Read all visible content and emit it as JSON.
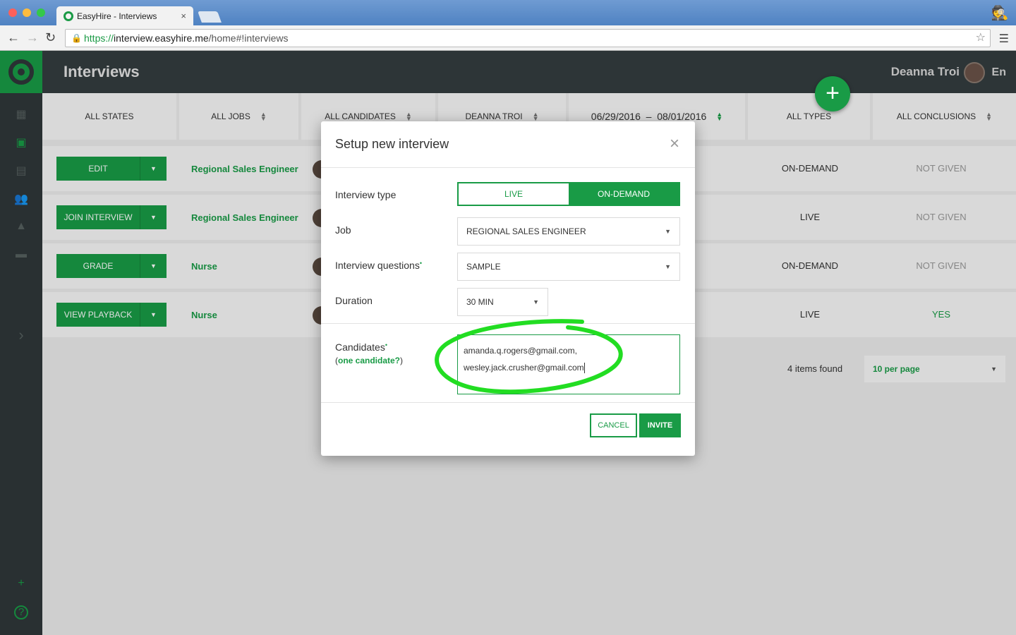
{
  "browser": {
    "tab_title": "EasyHire - Interviews",
    "tab_close": "×",
    "url_scheme": "https://",
    "url_host": "interview.easyhire.me",
    "url_path": "/home#!interviews"
  },
  "header": {
    "title": "Interviews",
    "user_name": "Deanna Troi",
    "language": "En",
    "add_button": "+"
  },
  "filters": [
    {
      "label": "ALL STATES",
      "sortable": false
    },
    {
      "label": "ALL JOBS",
      "sortable": true
    },
    {
      "label": "ALL CANDIDATES",
      "sortable": true
    },
    {
      "label": "DEANNA TROI",
      "sortable": true
    },
    {
      "label": "06/29/2016  –  08/01/2016",
      "sortable": true
    },
    {
      "label": "ALL TYPES",
      "sortable": false
    },
    {
      "label": "ALL CONCLUSIONS",
      "sortable": true
    }
  ],
  "rows": [
    {
      "action": "EDIT",
      "job": "Regional Sales Engineer",
      "type": "ON-DEMAND",
      "conclusion": "NOT GIVEN"
    },
    {
      "action": "JOIN INTERVIEW",
      "job": "Regional Sales Engineer",
      "type": "LIVE",
      "conclusion": "NOT GIVEN"
    },
    {
      "action": "GRADE",
      "job": "Nurse",
      "type": "ON-DEMAND",
      "conclusion": "NOT GIVEN"
    },
    {
      "action": "VIEW PLAYBACK",
      "job": "Nurse",
      "type": "LIVE",
      "conclusion": "YES"
    }
  ],
  "pagination": {
    "items_found": "4 items found",
    "per_page": "10 per page"
  },
  "modal": {
    "title": "Setup new interview",
    "close": "×",
    "interview_type_label": "Interview type",
    "type_options": [
      "LIVE",
      "ON-DEMAND"
    ],
    "type_selected": "ON-DEMAND",
    "job_label": "Job",
    "job_value": "REGIONAL SALES ENGINEER",
    "questions_label": "Interview questions",
    "questions_value": "SAMPLE",
    "duration_label": "Duration",
    "duration_value": "30 MIN",
    "candidates_label": "Candidates",
    "one_candidate_link": "one candidate?",
    "candidates_lines": [
      "amanda.q.rogers@gmail.com,",
      "wesley.jack.crusher@gmail.com"
    ],
    "cancel_label": "CANCEL",
    "invite_label": "INVITE"
  },
  "colors": {
    "accent": "#199b46",
    "sidebar": "#2f3739",
    "topbar": "#343d3f",
    "annotation": "#22dd22"
  }
}
